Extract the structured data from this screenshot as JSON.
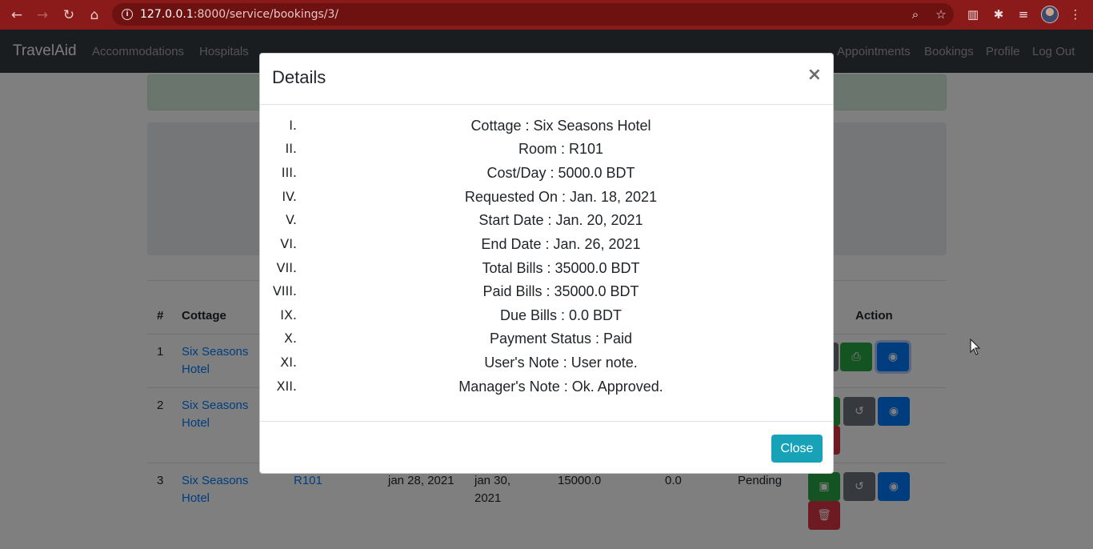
{
  "browser": {
    "url_host": "127.0.0.1",
    "url_path": ":8000/service/bookings/3/"
  },
  "navbar": {
    "brand": "TravelAid",
    "left_links": [
      "Accommodations",
      "Hospitals"
    ],
    "right_links": [
      "Appointments",
      "Bookings",
      "Profile",
      "Log Out"
    ]
  },
  "table": {
    "headers": {
      "num": "#",
      "cottage": "Cottage",
      "action": "Action"
    },
    "rows": [
      {
        "num": "1",
        "cottage": "Six Seasons Hotel"
      },
      {
        "num": "2",
        "cottage": "Six Seasons Hotel"
      },
      {
        "num": "3",
        "cottage": "Six Seasons Hotel",
        "room": "R101",
        "requested": "jan 28, 2021",
        "start": "jan 30, 2021",
        "total": "15000.0",
        "paid": "0.0",
        "status": "Pending"
      }
    ]
  },
  "modal": {
    "title": "Details",
    "close_x": "×",
    "items": [
      {
        "num": "I.",
        "text": "Cottage : Six Seasons Hotel"
      },
      {
        "num": "II.",
        "text": "Room : R101"
      },
      {
        "num": "III.",
        "text": "Cost/Day : 5000.0 BDT"
      },
      {
        "num": "IV.",
        "text": "Requested On : Jan. 18, 2021"
      },
      {
        "num": "V.",
        "text": "Start Date : Jan. 20, 2021"
      },
      {
        "num": "VI.",
        "text": "End Date : Jan. 26, 2021"
      },
      {
        "num": "VII.",
        "text": "Total Bills : 35000.0 BDT"
      },
      {
        "num": "VIII.",
        "text": "Paid Bills : 35000.0 BDT"
      },
      {
        "num": "IX.",
        "text": "Due Bills : 0.0 BDT"
      },
      {
        "num": "X.",
        "text": "Payment Status : Paid"
      },
      {
        "num": "XI.",
        "text": "User's Note : User note."
      },
      {
        "num": "XII.",
        "text": "Manager's Note : Ok. Approved."
      }
    ],
    "close_label": "Close"
  },
  "colors": {
    "chrome": "#8b1a1a",
    "navbar": "#343a40",
    "close_button": "#17a2b8",
    "link": "#007bff"
  }
}
